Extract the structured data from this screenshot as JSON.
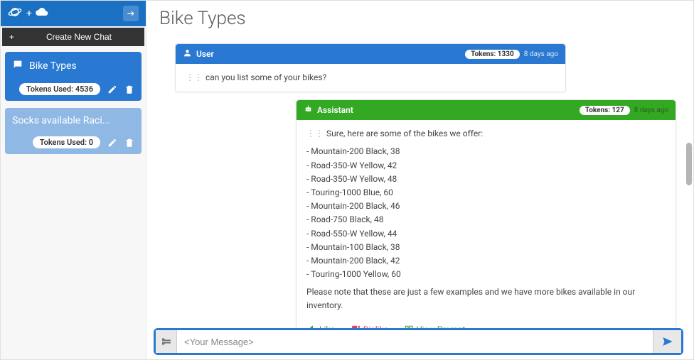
{
  "sidebar": {
    "create_label": "Create New Chat",
    "chats": [
      {
        "title": "Bike Types",
        "tokens_label": "Tokens Used: 4536",
        "active": true
      },
      {
        "title": "Socks available Raci...",
        "tokens_label": "Tokens Used: 0",
        "active": false
      }
    ]
  },
  "page": {
    "title": "Bike Types"
  },
  "messages": {
    "user": {
      "role_label": "User",
      "tokens": "Tokens: 1330",
      "time": "8 days ago",
      "text": "can you list some of your bikes?"
    },
    "assistant": {
      "role_label": "Assistant",
      "tokens": "Tokens: 127",
      "time": "8 days ago",
      "intro": "Sure, here are some of the bikes we offer:",
      "bikes": [
        "Mountain-200 Black, 38",
        "Road-350-W Yellow, 42",
        "Road-350-W Yellow, 48",
        "Touring-1000 Blue, 60",
        "Mountain-200 Black, 46",
        "Road-750 Black, 48",
        "Road-550-W Yellow, 44",
        "Mountain-100 Black, 38",
        "Mountain-200 Black, 42",
        "Touring-1000 Yellow, 60"
      ],
      "note": "Please note that these are just a few examples and we have more bikes available in our inventory.",
      "actions": {
        "like": "Like",
        "dislike": "Dislike",
        "view": "View Prompt"
      }
    }
  },
  "input": {
    "placeholder": "<Your Message>"
  }
}
